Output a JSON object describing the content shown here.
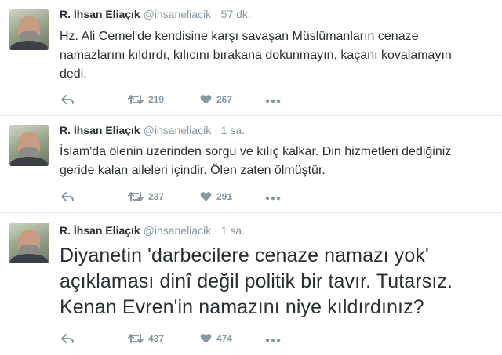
{
  "accent": "#8899a6",
  "tweets": [
    {
      "name": "R. İhsan Eliaçık",
      "handle": "@ihsaneliacik",
      "time": "57 dk.",
      "lines": [
        "Hz. Ali Cemel'de kendisine karşı savaşan Müslümanların cenaze",
        "namazlarını kıldırdı, kılıcını bırakana dokunmayın, kaçanı kovalamayın",
        "dedi."
      ],
      "retweets": "219",
      "likes": "267"
    },
    {
      "name": "R. İhsan Eliaçık",
      "handle": "@ihsaneliacik",
      "time": "1 sa.",
      "lines": [
        "İslam'da ölenin üzerinden sorgu ve kılıç kalkar. Din hizmetleri dediğiniz",
        "geride kalan aileleri içindir. Ölen zaten ölmüştür."
      ],
      "retweets": "237",
      "likes": "291"
    },
    {
      "name": "R. İhsan Eliaçık",
      "handle": "@ihsaneliacik",
      "time": "1 sa.",
      "lines": [
        "Diyanetin 'darbecilere cenaze namazı yok'",
        "açıklaması dinî değil politik bir tavır. Tutarsız.",
        "Kenan Evren'in namazını niye kıldırdınız?"
      ],
      "retweets": "437",
      "likes": "474"
    }
  ]
}
